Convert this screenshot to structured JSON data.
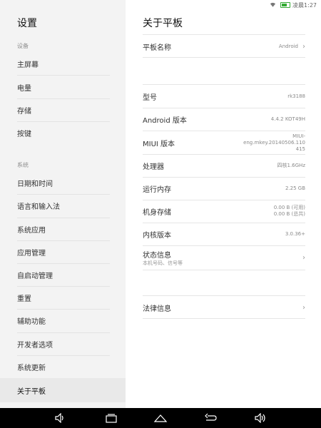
{
  "status_bar": {
    "time": "凌晨1:27"
  },
  "sidebar": {
    "title": "设置",
    "section_device": "设备",
    "section_system": "系统",
    "items": [
      {
        "label": "主屏幕"
      },
      {
        "label": "电量"
      },
      {
        "label": "存储"
      },
      {
        "label": "按键"
      },
      {
        "label": "日期和时间"
      },
      {
        "label": "语言和输入法"
      },
      {
        "label": "系统应用"
      },
      {
        "label": "应用管理"
      },
      {
        "label": "自启动管理"
      },
      {
        "label": "重置"
      },
      {
        "label": "辅助功能"
      },
      {
        "label": "开发者选项"
      },
      {
        "label": "系统更新"
      },
      {
        "label": "关于平板"
      }
    ]
  },
  "main": {
    "title": "关于平板",
    "rows": [
      {
        "label": "平板名称",
        "value": "Android"
      },
      {
        "label": "型号",
        "value": "rk3188"
      },
      {
        "label": "Android 版本",
        "value": "4.4.2 KOT49H"
      },
      {
        "label": "MIUI 版本",
        "value_lines": [
          "MIUI-",
          "eng.mkey.20140506.110",
          "415"
        ]
      },
      {
        "label": "处理器",
        "value": "四核1.6GHz"
      },
      {
        "label": "运行内存",
        "value": "2.25 GB"
      },
      {
        "label": "机身存储",
        "value_lines": [
          "0.00 B (可用)",
          "0.00 B (总共)"
        ]
      },
      {
        "label": "内核版本",
        "value": "3.0.36+"
      },
      {
        "label": "状态信息",
        "sublabel": "本机号码、信号等"
      },
      {
        "label": "法律信息"
      }
    ]
  }
}
